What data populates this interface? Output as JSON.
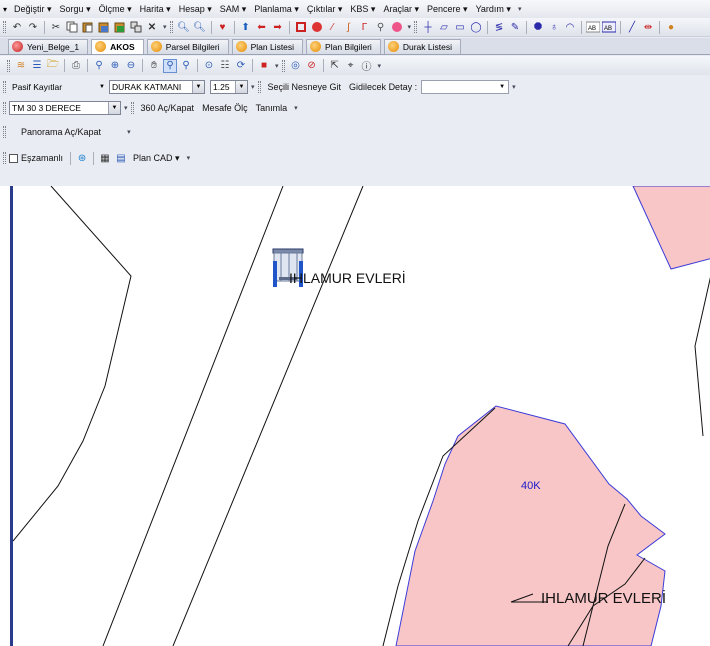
{
  "menubar": {
    "items": [
      "Değiştir",
      "Sorgu",
      "Ölçme",
      "Harita",
      "Hesap",
      "SAM",
      "Planlama",
      "Çıktılar",
      "KBS",
      "Araçlar",
      "Pencere",
      "Yardım"
    ]
  },
  "tabs": [
    {
      "label": "Yeni_Belge_1",
      "active": false,
      "icon": "red-circle-icon"
    },
    {
      "label": "AKOS",
      "active": true,
      "icon": "orange-circle-icon"
    },
    {
      "label": "Parsel Bilgileri",
      "active": false,
      "icon": "orange-circle-icon"
    },
    {
      "label": "Plan Listesi",
      "active": false,
      "icon": "orange-circle-icon"
    },
    {
      "label": "Plan Bilgileri",
      "active": false,
      "icon": "orange-circle-icon"
    },
    {
      "label": "Durak Listesi",
      "active": false,
      "icon": "orange-circle-icon"
    }
  ],
  "layerbar": {
    "records_value": "Pasif Kayıtlar",
    "layer_value": "DURAK KATMANI",
    "scale_value": "1.25",
    "goto_label": "Seçili Nesneye Git",
    "detail_label": "Gidilecek Detay :",
    "detail_value": ""
  },
  "projbar": {
    "projection_value": "TM 30 3 DERECE",
    "toggle_360": "360 Aç/Kapat",
    "measure": "Mesafe Ölç",
    "define": "Tanımla"
  },
  "panobar": {
    "panorama": "Panorama Aç/Kapat"
  },
  "planbar": {
    "sync": "Eşzamanlı",
    "plan_cad": "Plan CAD"
  },
  "map": {
    "labels": {
      "stop_label_top": "IHLAMUR EVLERİ",
      "parcel_label": "40K",
      "stop_label_bottom": "IHLAMUR EVLERİ"
    },
    "colors": {
      "parcel_fill": "#f8c6c6",
      "parcel_stroke": "#3b3bd8",
      "parcel_label": "#1a1acc",
      "frame": "#2a3a8c"
    }
  }
}
